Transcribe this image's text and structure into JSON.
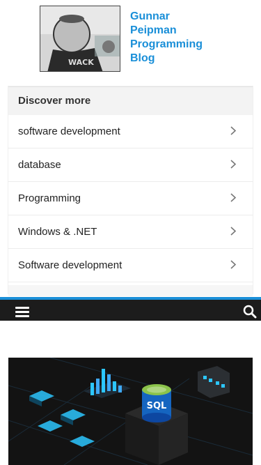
{
  "header": {
    "title_lines": [
      "Gunnar",
      "Peipman",
      "Programming",
      "Blog"
    ]
  },
  "discover": {
    "heading": "Discover more",
    "items": [
      {
        "label": "software development"
      },
      {
        "label": "database"
      },
      {
        "label": "Programming"
      },
      {
        "label": "Windows & .NET"
      },
      {
        "label": "Software development"
      }
    ]
  },
  "hero": {
    "badge": "SQL"
  },
  "icons": {
    "menu": "hamburger-icon",
    "search": "search-icon",
    "chevron": "chevron-right-icon"
  },
  "colors": {
    "accent": "#1a8fd8",
    "navbar": "#1c1c1c"
  }
}
